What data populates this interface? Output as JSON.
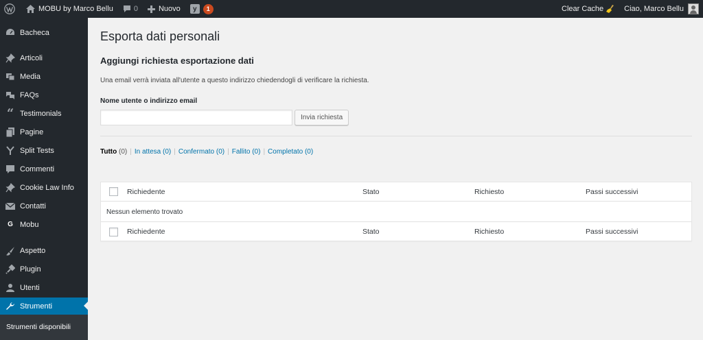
{
  "admin_bar": {
    "site_name": "MOBU by Marco Bellu",
    "comments_count": "0",
    "new_label": "Nuovo",
    "yoast_badge": "1",
    "clear_cache": "Clear Cache",
    "greeting": "Ciao, Marco Bellu"
  },
  "sidebar": {
    "items": [
      {
        "label": "Bacheca",
        "icon": "dashboard-icon"
      },
      {
        "label": "Articoli",
        "icon": "pin-icon"
      },
      {
        "label": "Media",
        "icon": "media-icon"
      },
      {
        "label": "FAQs",
        "icon": "faq-icon"
      },
      {
        "label": "Testimonials",
        "icon": "quote-icon"
      },
      {
        "label": "Pagine",
        "icon": "page-icon"
      },
      {
        "label": "Split Tests",
        "icon": "split-icon"
      },
      {
        "label": "Commenti",
        "icon": "comment-icon"
      },
      {
        "label": "Cookie Law Info",
        "icon": "pin-icon"
      },
      {
        "label": "Contatti",
        "icon": "mail-icon"
      },
      {
        "label": "Mobu",
        "icon": "g-logo-icon"
      },
      {
        "label": "Aspetto",
        "icon": "brush-icon"
      },
      {
        "label": "Plugin",
        "icon": "plugin-icon"
      },
      {
        "label": "Utenti",
        "icon": "user-icon"
      },
      {
        "label": "Strumenti",
        "icon": "wrench-icon"
      }
    ],
    "active": "Strumenti",
    "submenu": [
      "Strumenti disponibili"
    ]
  },
  "page": {
    "title": "Esporta dati personali",
    "section_title": "Aggiungi richiesta esportazione dati",
    "description": "Una email verrà inviata all'utente a questo indirizzo chiedendogli di verificare la richiesta.",
    "field_label": "Nome utente o indirizzo email",
    "field_value": "",
    "submit_label": "Invia richiesta"
  },
  "filters": [
    {
      "label": "Tutto",
      "count": "(0)",
      "current": true
    },
    {
      "label": "In attesa",
      "count": "(0)",
      "current": false
    },
    {
      "label": "Confermato",
      "count": "(0)",
      "current": false
    },
    {
      "label": "Fallito",
      "count": "(0)",
      "current": false
    },
    {
      "label": "Completato",
      "count": "(0)",
      "current": false
    }
  ],
  "table": {
    "columns": [
      "Richiedente",
      "Stato",
      "Richiesto",
      "Passi successivi"
    ],
    "empty_message": "Nessun elemento trovato"
  },
  "colors": {
    "admin_bar_bg": "#23282d",
    "active_menu": "#0073aa",
    "link": "#0073aa",
    "badge": "#ca4a1f"
  }
}
